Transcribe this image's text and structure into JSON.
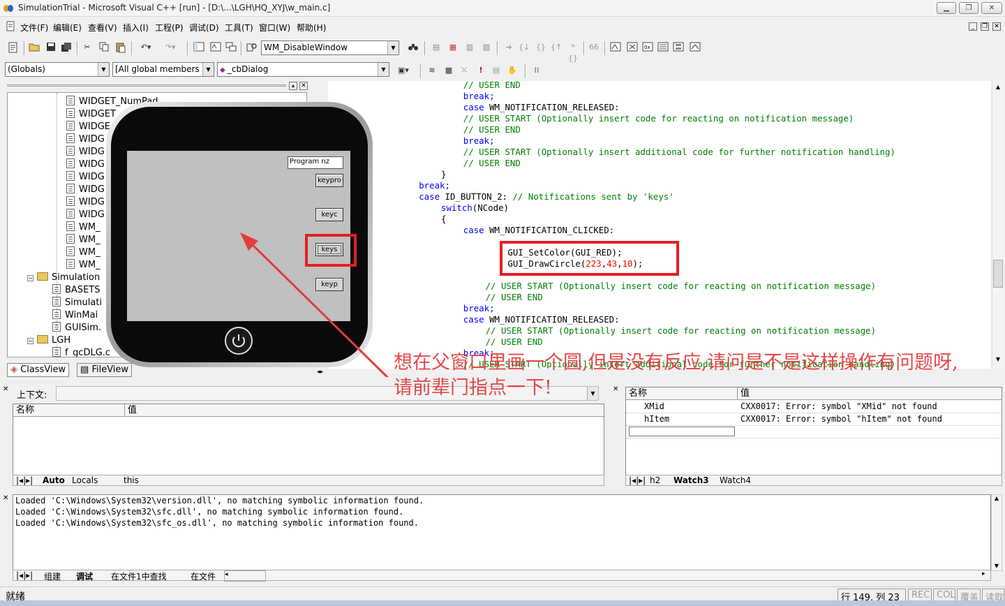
{
  "window": {
    "title": "SimulationTrial - Microsoft Visual C++ [run] - [D:\\...\\LGH\\HQ_XYJ\\w_main.c]"
  },
  "menu": [
    "文件(F)",
    "编辑(E)",
    "查看(V)",
    "插入(I)",
    "工程(P)",
    "调试(D)",
    "工具(T)",
    "窗口(W)",
    "帮助(H)"
  ],
  "toolbar": {
    "find_combo": "WM_DisableWindow"
  },
  "wizardbar": {
    "scope": "(Globals)",
    "filter": "[All global members",
    "member": "_cbDialog"
  },
  "tree": {
    "items": [
      {
        "label": "WIDGET_NumPad",
        "type": "file"
      },
      {
        "label": "WIDGET_",
        "type": "file"
      },
      {
        "label": "WIDGE",
        "type": "file"
      },
      {
        "label": "WIDG",
        "type": "file"
      },
      {
        "label": "WIDG",
        "type": "file"
      },
      {
        "label": "WIDG",
        "type": "file"
      },
      {
        "label": "WIDG",
        "type": "file"
      },
      {
        "label": "WIDG",
        "type": "file"
      },
      {
        "label": "WIDG",
        "type": "file"
      },
      {
        "label": "WIDG",
        "type": "file"
      },
      {
        "label": "WM_",
        "type": "file"
      },
      {
        "label": "WM_",
        "type": "file"
      },
      {
        "label": "WM_",
        "type": "file"
      },
      {
        "label": "WM_",
        "type": "file"
      },
      {
        "label": "Simulation",
        "type": "folder"
      },
      {
        "label": "BASETS",
        "type": "file"
      },
      {
        "label": "Simulati",
        "type": "file"
      },
      {
        "label": "WinMai",
        "type": "file"
      },
      {
        "label": "GUISim.",
        "type": "file"
      },
      {
        "label": "LGH",
        "type": "folder"
      },
      {
        "label": "f_gcDLG.c",
        "type": "file"
      }
    ],
    "tabs": [
      "ClassView",
      "FileView"
    ]
  },
  "code": {
    "lines": [
      {
        "t": "// USER END",
        "c": "cm",
        "i": 6
      },
      {
        "t": "break;",
        "c": "kw",
        "i": 6
      },
      {
        "t": "case WM_NOTIFICATION_RELEASED:",
        "c": "mix_case",
        "i": 6
      },
      {
        "t": "// USER START (Optionally insert code for reacting on notification message)",
        "c": "cm",
        "i": 6
      },
      {
        "t": "// USER END",
        "c": "cm",
        "i": 6
      },
      {
        "t": "break;",
        "c": "kw",
        "i": 6
      },
      {
        "t": "// USER START (Optionally insert additional code for further notification handling)",
        "c": "cm",
        "i": 6
      },
      {
        "t": "// USER END",
        "c": "cm",
        "i": 6
      },
      {
        "t": "}",
        "c": "",
        "i": 5
      },
      {
        "t": "break;",
        "c": "kw",
        "i": 4
      },
      {
        "t": "case ID_BUTTON_2: // Notifications sent by 'keys'",
        "c": "mix_button",
        "i": 4
      },
      {
        "t": "switch(NCode)",
        "c": "mix_switch",
        "i": 5
      },
      {
        "t": "{",
        "c": "",
        "i": 5
      },
      {
        "t": "case WM_NOTIFICATION_CLICKED:",
        "c": "mix_case",
        "i": 6
      },
      {
        "t": "",
        "c": "",
        "i": 0
      },
      {
        "t": "GUI_SetColor(GUI_RED);",
        "c": "",
        "i": 8
      },
      {
        "t": "GUI_DrawCircle(223,43,10);",
        "c": "mix_num",
        "i": 8
      },
      {
        "t": "",
        "c": "",
        "i": 0
      },
      {
        "t": "// USER START (Optionally insert code for reacting on notification message)",
        "c": "cm",
        "i": 7
      },
      {
        "t": "// USER END",
        "c": "cm",
        "i": 7
      },
      {
        "t": "break;",
        "c": "kw",
        "i": 6
      },
      {
        "t": "case WM_NOTIFICATION_RELEASED:",
        "c": "mix_case",
        "i": 6
      },
      {
        "t": "// USER START (Optionally insert code for reacting on notification message)",
        "c": "cm",
        "i": 7
      },
      {
        "t": "// USER END",
        "c": "cm",
        "i": 7
      },
      {
        "t": "break;",
        "c": "kw",
        "i": 6
      },
      {
        "t": "// USER START (Optionally insert additional code for further notification handling)",
        "c": "cm",
        "i": 6
      }
    ]
  },
  "simulator": {
    "edit_text": "Program nz",
    "buttons": [
      "keypro",
      "keyc",
      "keys",
      "keyp"
    ]
  },
  "annotation": {
    "line1": "想在父窗口里画一个圆,但是没有反应,请问是不是这样操作有问题呀,",
    "line2": "请前辈门指点一下!"
  },
  "variables": {
    "context_label": "上下文:",
    "col_name": "名称",
    "col_value": "值",
    "tabs": [
      "Auto",
      "Locals",
      "this"
    ]
  },
  "watch": {
    "col_name": "名称",
    "col_value": "值",
    "rows": [
      {
        "name": "XMid",
        "value": "CXX0017: Error: symbol \"XMid\" not found"
      },
      {
        "name": "hItem",
        "value": "CXX0017: Error: symbol \"hItem\" not found"
      }
    ],
    "tabs": [
      "h2",
      "Watch3",
      "Watch4"
    ]
  },
  "output": {
    "lines": [
      "Loaded 'C:\\Windows\\System32\\version.dll', no matching symbolic information found.",
      "Loaded 'C:\\Windows\\System32\\sfc.dll', no matching symbolic information found.",
      "Loaded 'C:\\Windows\\System32\\sfc_os.dll', no matching symbolic information found."
    ],
    "tabs": [
      "组建",
      "调试",
      "在文件1中查找",
      "在文件"
    ]
  },
  "status": {
    "ready": "就绪",
    "position": "行 149, 列 23",
    "rec": "REC",
    "col": "COL",
    "ovr": "覆盖",
    "read": "读取"
  },
  "colors": {
    "keyword": "#0000ff",
    "comment": "#008000",
    "number": "#ff0000",
    "highlight": "#e51f25"
  }
}
